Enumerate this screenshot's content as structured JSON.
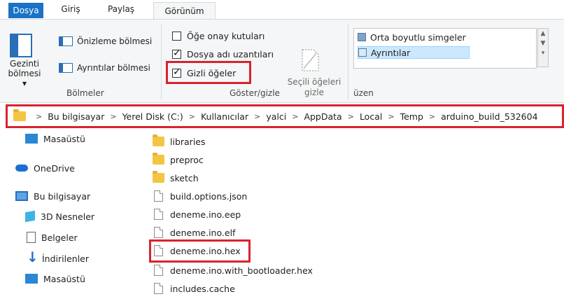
{
  "tabs": [
    "Dosya",
    "Giriş",
    "Paylaş",
    "Görünüm"
  ],
  "ribbon": {
    "panes": {
      "nav_pane_label_line1": "Gezinti",
      "nav_pane_label_line2": "bölmesi ▾",
      "preview_pane": "Önizleme bölmesi",
      "details_pane": "Ayrıntılar bölmesi",
      "group_title": "Bölmeler"
    },
    "show_hide": {
      "item_checkboxes": "Öğe onay kutuları",
      "file_name_extensions": "Dosya adı uzantıları",
      "hidden_items": "Gizli öğeler",
      "hide_selected_line1": "Seçili öğeleri",
      "hide_selected_line2": "gizle",
      "group_title": "Göster/gizle",
      "checked": {
        "item_checkboxes": false,
        "file_name_extensions": true,
        "hidden_items": true
      }
    },
    "layout": {
      "medium_icons": "Orta boyutlu simgeler",
      "details": "Ayrıntılar",
      "group_title": "üzen",
      "scroll_up": "▲",
      "scroll_down": "▼",
      "scroll_more": "▾"
    }
  },
  "address_bar": {
    "crumbs": [
      "Bu bilgisayar",
      "Yerel Disk (C:)",
      "Kullanıcılar",
      "yalci",
      "AppData",
      "Local",
      "Temp",
      "arduino_build_532604"
    ]
  },
  "nav_pane": [
    {
      "label": "Masaüstü",
      "icon": "desktop-icon"
    },
    {
      "label": "OneDrive",
      "icon": "cloud-icon"
    },
    {
      "label": "Bu bilgisayar",
      "icon": "computer-icon"
    },
    {
      "label": "3D Nesneler",
      "icon": "3d-objects-icon"
    },
    {
      "label": "Belgeler",
      "icon": "documents-icon"
    },
    {
      "label": "İndirilenler",
      "icon": "downloads-icon"
    },
    {
      "label": "Masaüstü",
      "icon": "desktop-icon"
    }
  ],
  "files": [
    {
      "name": "libraries",
      "type": "folder"
    },
    {
      "name": "preproc",
      "type": "folder"
    },
    {
      "name": "sketch",
      "type": "folder"
    },
    {
      "name": "build.options.json",
      "type": "file"
    },
    {
      "name": "deneme.ino.eep",
      "type": "file"
    },
    {
      "name": "deneme.ino.elf",
      "type": "file"
    },
    {
      "name": "deneme.ino.hex",
      "type": "file"
    },
    {
      "name": "deneme.ino.with_bootloader.hex",
      "type": "file"
    },
    {
      "name": "includes.cache",
      "type": "file"
    }
  ],
  "colors": {
    "accent": "#1a72c7",
    "highlight_red": "#d9232e",
    "folder": "#f4c542"
  }
}
